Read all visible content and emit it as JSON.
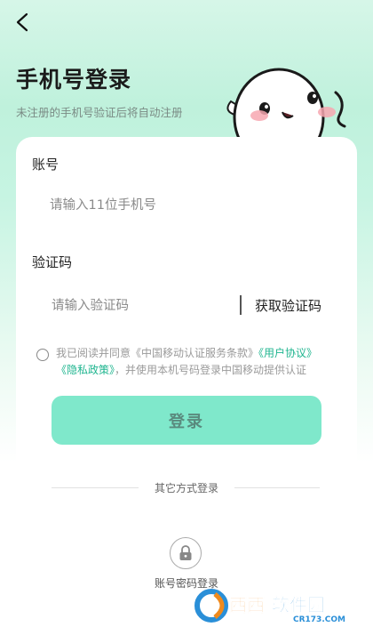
{
  "header": {
    "title": "手机号登录",
    "subtitle": "未注册的手机号验证后将自动注册"
  },
  "form": {
    "account_label": "账号",
    "phone_placeholder": "请输入11位手机号",
    "code_label": "验证码",
    "code_placeholder": "请输入验证码",
    "get_code_label": "获取验证码"
  },
  "agreement": {
    "prefix": "我已阅读并同意《中国移动认证服务条款》",
    "user_agreement": "《用户协议》",
    "privacy_policy": "《隐私政策》",
    "suffix": "，并使用本机号码登录中国移动提供认证"
  },
  "login_button": "登录",
  "other_login": {
    "divider_text": "其它方式登录",
    "password_login_label": "账号密码登录"
  },
  "watermark": {
    "brand": "西西软件园",
    "site": "CR173.COM"
  },
  "colors": {
    "accent": "#1fb58f",
    "button": "#7fe8cb"
  }
}
